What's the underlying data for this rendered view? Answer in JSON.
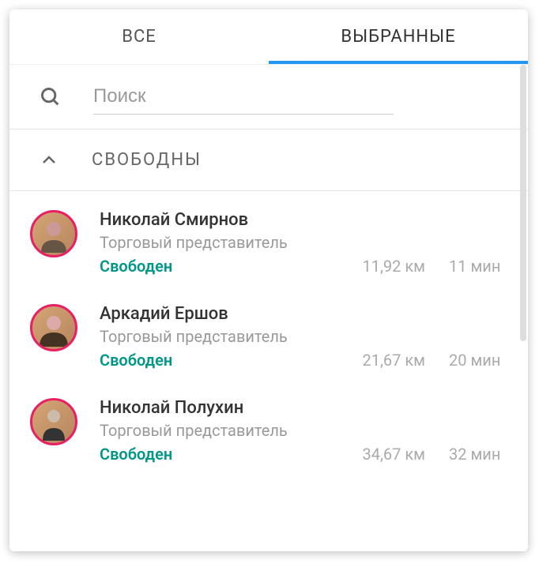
{
  "tabs": {
    "all": "ВСЕ",
    "selected": "ВЫБРАННЫЕ"
  },
  "search": {
    "placeholder": "Поиск"
  },
  "section": {
    "title": "СВОБОДНЫ"
  },
  "statusColor": "#009688",
  "accentColor": "#E91E63",
  "items": [
    {
      "name": "Николай Смирнов",
      "role": "Торговый представитель",
      "status": "Свободен",
      "distance": "11,92 км",
      "time": "11 мин"
    },
    {
      "name": "Аркадий Ершов",
      "role": "Торговый представитель",
      "status": "Свободен",
      "distance": "21,67 км",
      "time": "20 мин"
    },
    {
      "name": "Николай Полухин",
      "role": "Торговый представитель",
      "status": "Свободен",
      "distance": "34,67 км",
      "time": "32 мин"
    }
  ]
}
